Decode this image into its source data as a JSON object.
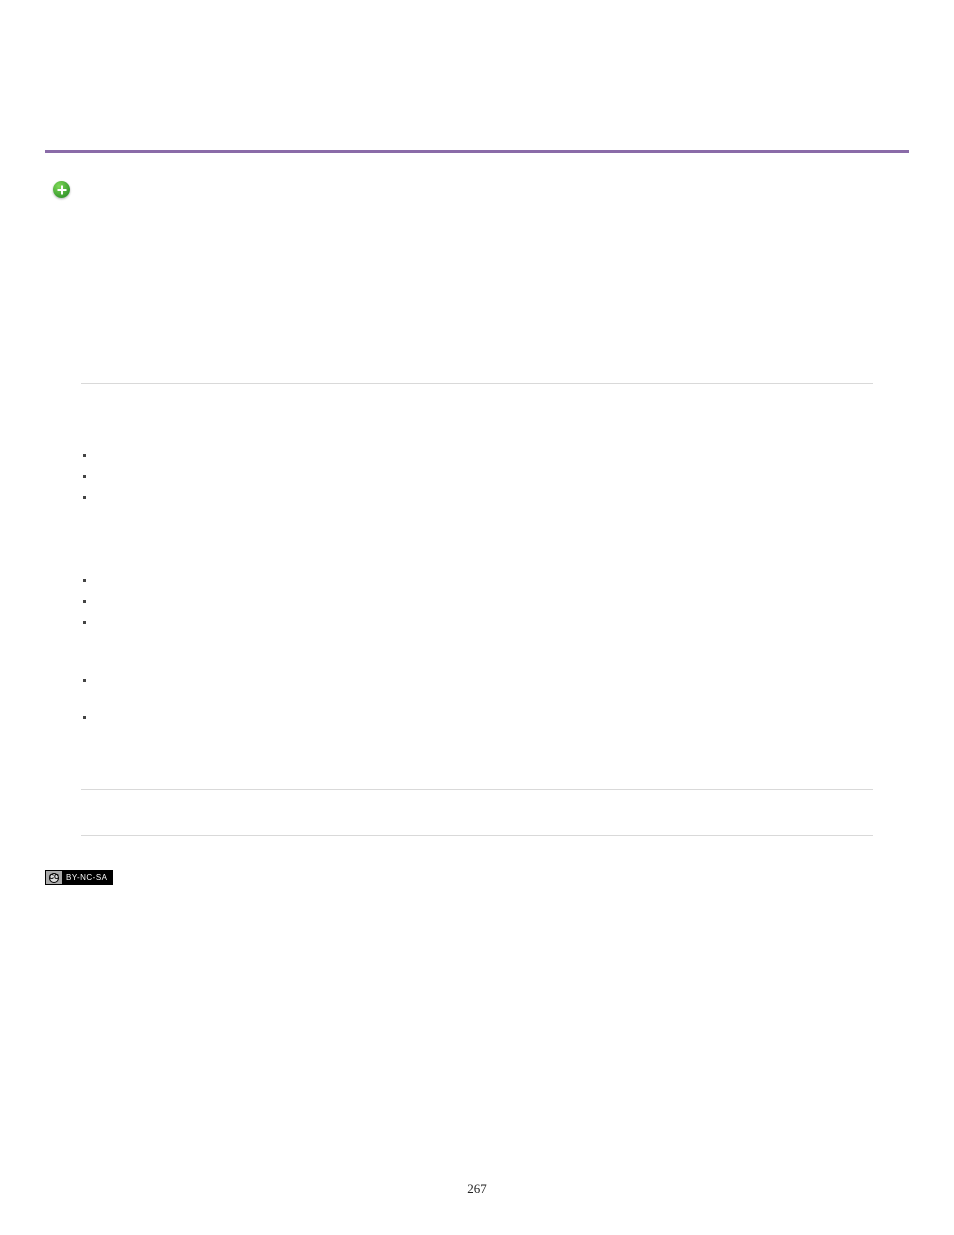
{
  "page_number": "267",
  "license_badge": {
    "left_text": "CC",
    "right_text": "BY-NC-SA"
  },
  "plus_icon": "plus-icon"
}
